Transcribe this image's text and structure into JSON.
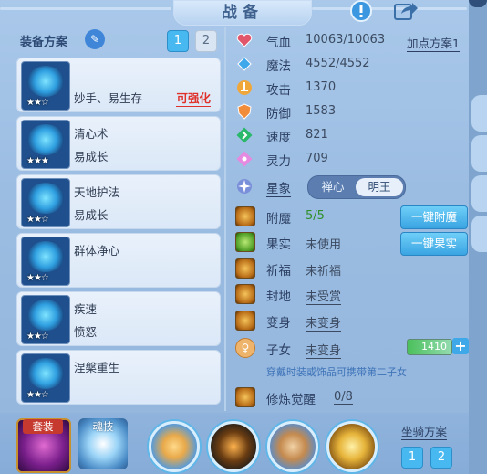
{
  "header": {
    "title": "战备"
  },
  "plans": {
    "label": "装备方案",
    "buttons": [
      "1",
      "2"
    ]
  },
  "skills": [
    {
      "name": "妙手、易生存",
      "sub": "",
      "upgrade": "可强化",
      "stars": "★★☆"
    },
    {
      "name": "清心术",
      "sub": "易成长",
      "upgrade": "",
      "stars": "★★★"
    },
    {
      "name": "天地护法",
      "sub": "易成长",
      "upgrade": "",
      "stars": "★★☆"
    },
    {
      "name": "群体净心",
      "sub": "",
      "upgrade": "",
      "stars": "★★☆"
    },
    {
      "name": "疾速",
      "sub": "愤怒",
      "upgrade": "",
      "stars": "★★☆"
    },
    {
      "name": "涅槃重生",
      "sub": "",
      "upgrade": "",
      "stars": "★★☆"
    }
  ],
  "stats": [
    {
      "label": "气血",
      "value": "10063/10063",
      "color": "#e2566b",
      "icon": "heart-icon"
    },
    {
      "label": "魔法",
      "value": "4552/4552",
      "color": "#3ea8ea",
      "icon": "diamond-icon"
    },
    {
      "label": "攻击",
      "value": "1370",
      "color": "#f0a73a",
      "icon": "sword-icon"
    },
    {
      "label": "防御",
      "value": "1583",
      "color": "#f08c3a",
      "icon": "shield-icon"
    },
    {
      "label": "速度",
      "value": "821",
      "color": "#29b86a",
      "icon": "speed-icon"
    },
    {
      "label": "灵力",
      "value": "709",
      "color": "#e58ae0",
      "icon": "spirit-icon"
    }
  ],
  "add_plan": "加点方案1",
  "constellation": {
    "label": "星象",
    "options": [
      "禅心",
      "明王"
    ],
    "selected": "明王"
  },
  "rows": [
    {
      "label": "附魔",
      "value": "5/5",
      "button": "一键附魔"
    },
    {
      "label": "果实",
      "value": "未使用",
      "button": "一键果实"
    },
    {
      "label": "祈福",
      "value": "未祈福",
      "button": ""
    },
    {
      "label": "封地",
      "value": "未受赏",
      "button": ""
    },
    {
      "label": "变身",
      "value": "未变身",
      "button": ""
    }
  ],
  "child": {
    "label": "子女",
    "value": "未变身",
    "points": "1410",
    "plus": "+"
  },
  "hint": "穿戴时装或饰品可携带第二子女",
  "cultivation": {
    "label": "修炼觉醒",
    "value": "0/8"
  },
  "bottom": {
    "suit_label": "套装",
    "soul_label": "魂技",
    "mount_label": "坐骑方案",
    "mount_buttons": [
      "1",
      "2"
    ]
  }
}
